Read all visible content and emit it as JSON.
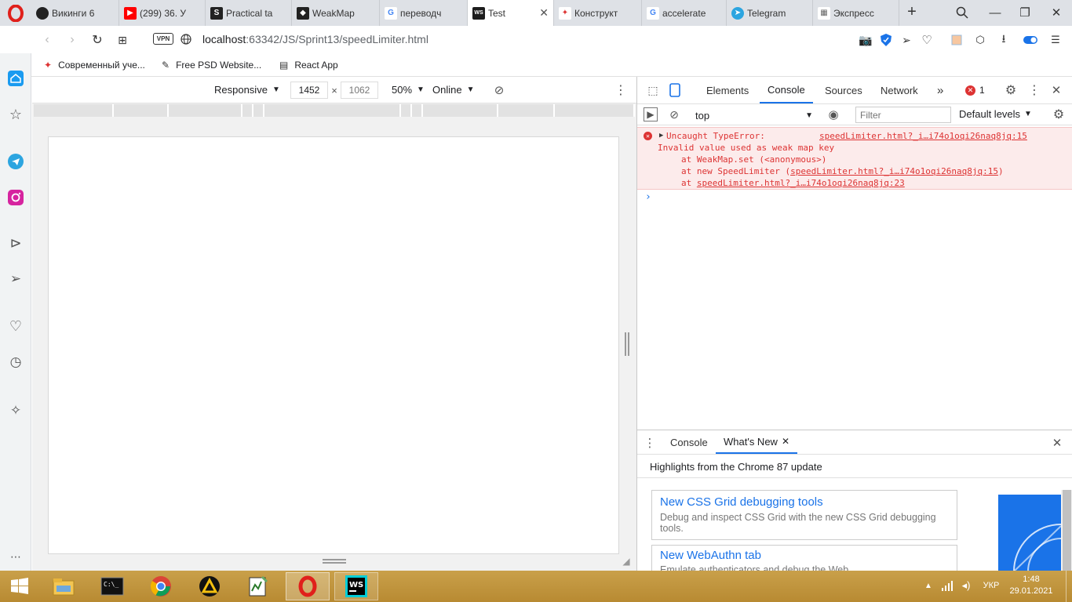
{
  "browser": {
    "tabs": [
      {
        "label": "Викинги 6",
        "fav_color": "#222"
      },
      {
        "label": "(299) 36. У",
        "fav_color": "#ff0000"
      },
      {
        "label": "Practical ta",
        "fav_color": "#222",
        "fav_text": "S"
      },
      {
        "label": "WeakMap",
        "fav_color": "#222"
      },
      {
        "label": "переводч",
        "fav_color": "#4285f4",
        "fav_text": "G"
      },
      {
        "label": "Test",
        "fav_color": "#1d1d1d",
        "fav_text": "WS",
        "active": true
      },
      {
        "label": "Конструкт",
        "fav_color": "#d33"
      },
      {
        "label": "accelerate",
        "fav_color": "#4285f4",
        "fav_text": "G"
      },
      {
        "label": "Telegram",
        "fav_color": "#2ca5e0"
      },
      {
        "label": "Экспресс",
        "fav_color": "#666"
      }
    ],
    "url_host": "localhost",
    "url_rest": ":63342/JS/Sprint13/speedLimiter.html",
    "vpn_label": "VPN",
    "bookmarks": [
      "Современный уче...",
      "Free PSD Website...",
      "React App"
    ]
  },
  "device_toolbar": {
    "mode": "Responsive",
    "width": "1452",
    "height": "1062",
    "times": "×",
    "zoom": "50%",
    "network": "Online"
  },
  "devtools": {
    "tabs": [
      "Elements",
      "Console",
      "Sources",
      "Network"
    ],
    "more": "»",
    "error_count": "1",
    "context": "top",
    "filter_placeholder": "Filter",
    "levels": "Default levels",
    "error": {
      "title": "Uncaught TypeError:",
      "source": "speedLimiter.html?_i…i74o1oqi26naq8jq:15",
      "line1": "Invalid value used as weak map key",
      "line2": "at WeakMap.set (<anonymous>)",
      "line3_pre": "at new SpeedLimiter (",
      "line3_link": "speedLimiter.html?_i…i74o1oqi26naq8jq:15",
      "line3_post": ")",
      "line4_pre": "at ",
      "line4_link": "speedLimiter.html?_i…i74o1oqi26naq8jq:23"
    },
    "prompt": "›",
    "drawer": {
      "tabs": [
        "Console",
        "What's New"
      ],
      "headline": "Highlights from the Chrome 87 update",
      "cards": [
        {
          "title": "New CSS Grid debugging tools",
          "desc": "Debug and inspect CSS Grid with the new CSS Grid debugging tools."
        },
        {
          "title": "New WebAuthn tab",
          "desc": "Emulate authenticators and debug the Web..."
        }
      ]
    }
  },
  "taskbar": {
    "lang": "УКР",
    "time": "1:48",
    "date": "29.01.2021"
  },
  "colors": {
    "accent": "#1a73e8",
    "error": "#d33",
    "opera_red": "#e0201b"
  }
}
